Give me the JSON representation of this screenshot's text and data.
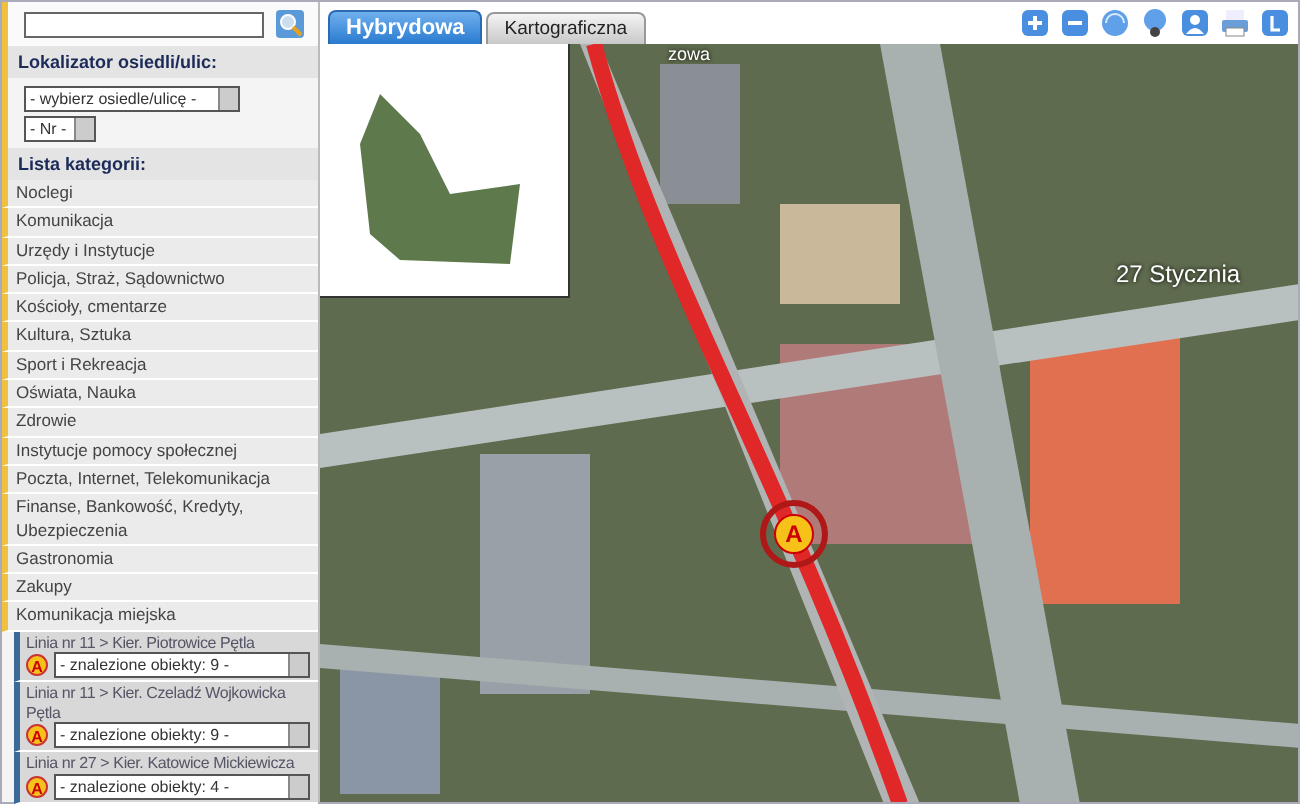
{
  "locator": {
    "title": "Lokalizator osiedli/ulic:",
    "street_select": "- wybierz osiedle/ulicę -",
    "number_select": "- Nr -"
  },
  "categories": {
    "title": "Lista kategorii:",
    "items": [
      {
        "label": "Noclegi"
      },
      {
        "label": "Komunikacja"
      },
      {
        "label": "Urzędy i Instytucje"
      },
      {
        "label": "Policja, Straż, Sądownictwo"
      },
      {
        "label": "Kościoły, cmentarze"
      },
      {
        "label": "Kultura, Sztuka"
      },
      {
        "label": "Sport i Rekreacja"
      },
      {
        "label": "Oświata, Nauka"
      },
      {
        "label": "Zdrowie"
      },
      {
        "label": "Instytucje pomocy społecznej"
      },
      {
        "label": "Poczta, Internet, Telekomunikacja"
      },
      {
        "label": "Finanse, Bankowość, Kredyty, Ubezpieczenia"
      },
      {
        "label": "Gastronomia"
      },
      {
        "label": "Zakupy"
      },
      {
        "label": "Komunikacja miejska",
        "children": [
          {
            "label": "Linia nr 11 > Kier. Piotrowice Pętla",
            "marker": "A",
            "select": "- znalezione obiekty: 9 -"
          },
          {
            "label": "Linia nr 11 > Kier. Czeladź Wojkowicka Pętla",
            "marker": "A",
            "select": "- znalezione obiekty: 9 -"
          },
          {
            "label": "Linia nr 27 > Kier. Katowice Mickiewicza",
            "marker": "A",
            "select": "- znalezione obiekty: 4 -"
          }
        ]
      }
    ]
  },
  "map_tabs": [
    {
      "label": "Hybrydowa",
      "selected": true
    },
    {
      "label": "Kartograficzna",
      "selected": false
    }
  ],
  "map": {
    "street_labels": [
      "27 Stycznia",
      "zowa"
    ],
    "marker": "A"
  }
}
